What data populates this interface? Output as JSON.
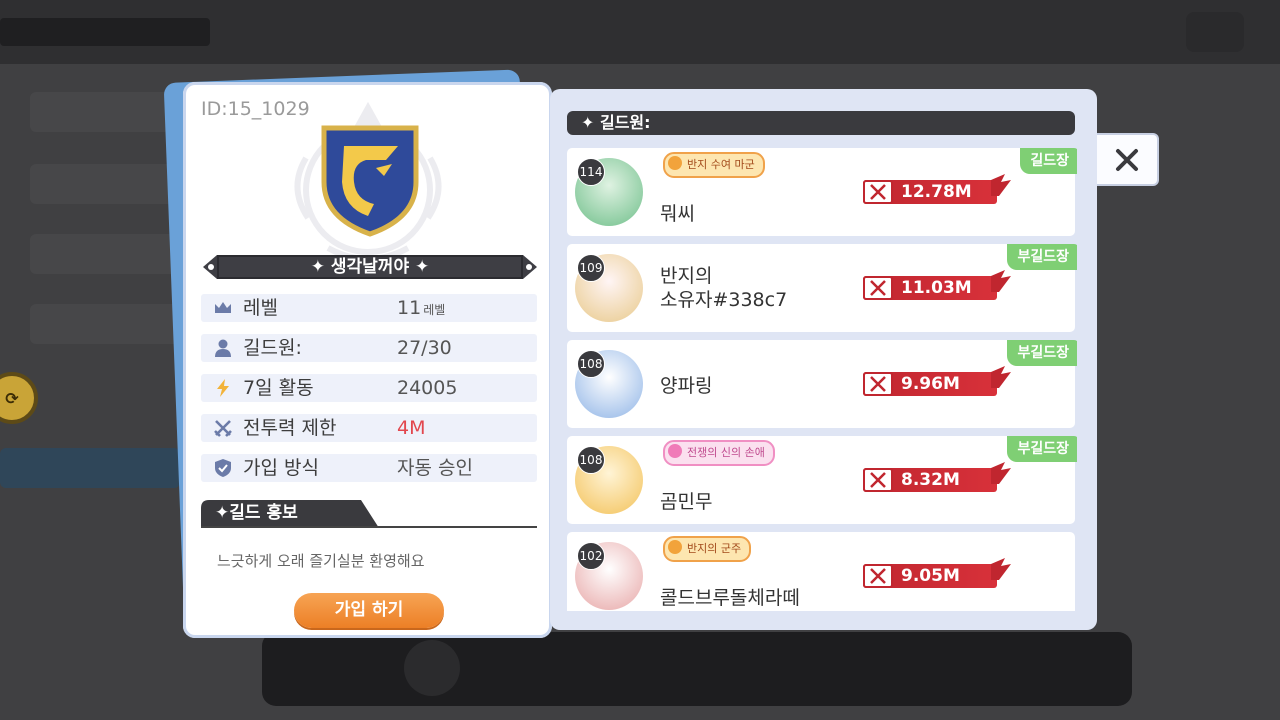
{
  "guild": {
    "id_text": "ID:15_1029",
    "name": "생각날꺼야",
    "rows": [
      {
        "icon": "crown-icon",
        "label": "레벨",
        "value": "11",
        "unit": "레벨"
      },
      {
        "icon": "person-icon",
        "label": "길드원:",
        "value": "27/30"
      },
      {
        "icon": "lightning-icon",
        "label": "7일 활동",
        "value": "24005"
      },
      {
        "icon": "crossed-swords-icon",
        "label": "전투력 제한",
        "value": "4M",
        "value_color": "#e2474e"
      },
      {
        "icon": "shield-check-icon",
        "label": "가입 방식",
        "value": "자동 승인"
      }
    ],
    "promo_title": "길드 홍보",
    "promo_text": "느긋하게 오래 즐기실분 환영해요",
    "join_button": "가입 하기"
  },
  "members_panel": {
    "header": "길드원:",
    "members": [
      {
        "level": "114",
        "name": "뭐씨",
        "title": "반지 수여 마군",
        "title_style": "gold",
        "role": "길드장",
        "power": "12.78M"
      },
      {
        "level": "109",
        "name_line1": "반지의",
        "name_line2": "소유자#338c7",
        "role": "부길드장",
        "power": "11.03M"
      },
      {
        "level": "108",
        "name": "양파링",
        "role": "부길드장",
        "power": "9.96M"
      },
      {
        "level": "108",
        "name": "곰민무",
        "title": "전쟁의 신의 손애",
        "title_style": "pink",
        "role": "부길드장",
        "power": "8.32M"
      },
      {
        "level": "102",
        "name": "콜드브루돌체라떼",
        "title": "반지의 군주",
        "title_style": "gold",
        "power": "9.05M"
      }
    ]
  },
  "colors": {
    "accent_orange": "#ec7f26",
    "power_red": "#c0262f",
    "role_green": "#7fcf74",
    "panel_bg": "#dfe5f4"
  }
}
